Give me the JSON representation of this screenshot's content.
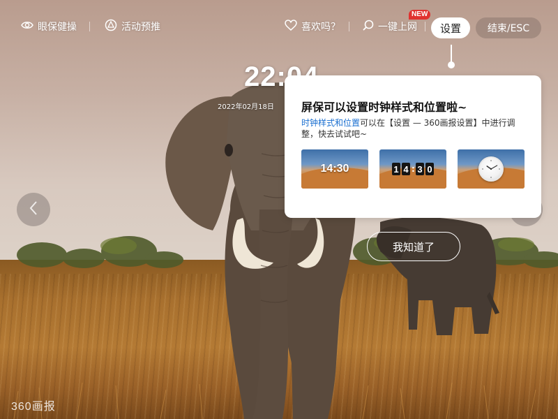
{
  "topbar": {
    "eye_care_label": "眼保健操",
    "activity_label": "活动预推",
    "like_label": "喜欢吗？",
    "one_click_label": "一键上网",
    "new_badge": "NEW",
    "settings_label": "设置",
    "exit_label": "结束/ESC"
  },
  "clock": {
    "time": "22:04",
    "date": "2022年02月18日"
  },
  "popup": {
    "title": "屏保可以设置时钟样式和位置啦~",
    "desc_highlight": "时钟样式和位置",
    "desc_rest": "可以在【设置 — 360画报设置】中进行调整，快去试试吧~",
    "thumbnails": [
      {
        "style": "digital",
        "text": "14:30"
      },
      {
        "style": "flip",
        "digits": [
          "1",
          "4",
          "3",
          "0"
        ]
      },
      {
        "style": "analog",
        "hour": 10,
        "minute": 10
      }
    ]
  },
  "gotit_label": "我知道了",
  "logo": "360画报",
  "icons": {
    "eye": "eye-icon",
    "activity": "activity-icon",
    "like": "heart-icon",
    "one_click": "search-icon",
    "prev": "chevron-left-icon",
    "next": "chevron-right-icon"
  }
}
